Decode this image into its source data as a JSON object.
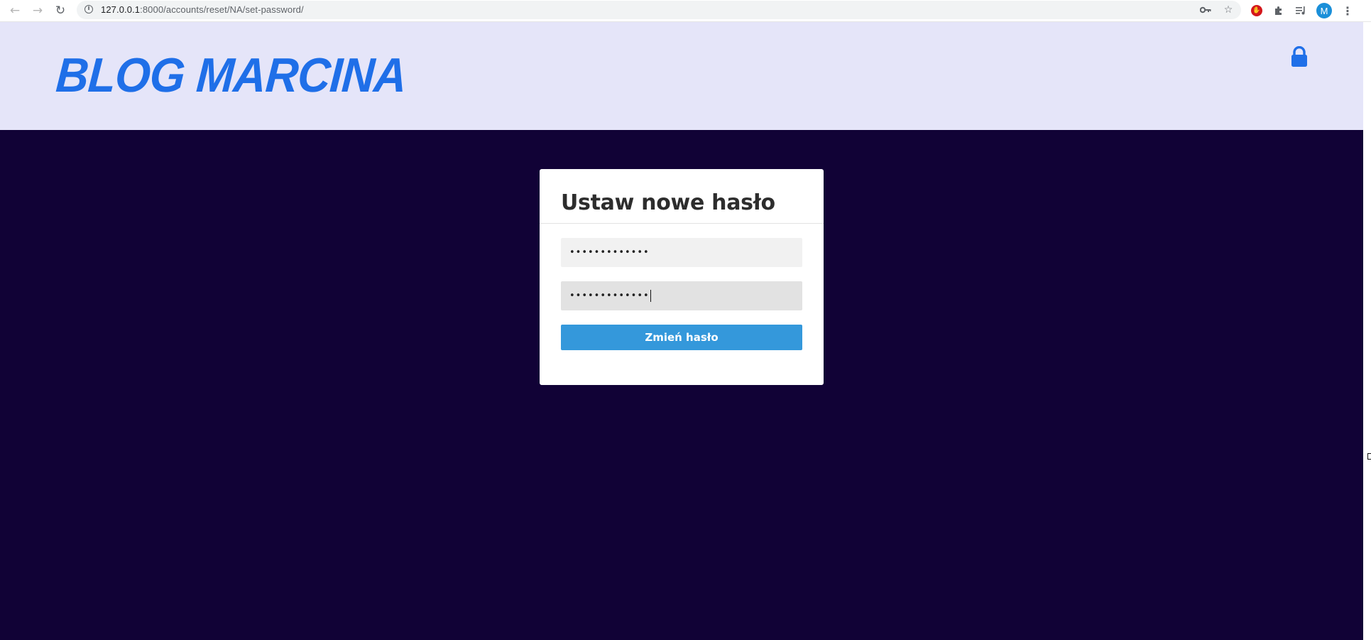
{
  "browser": {
    "back_icon": "arrow-left-icon",
    "forward_icon": "arrow-right-icon",
    "reload_icon": "reload-icon",
    "url_host": "127.0.0.1",
    "url_path": ":8000/accounts/reset/NA/set-password/",
    "avatar_letter": "M",
    "icons": [
      "info-icon",
      "key-icon",
      "star-icon",
      "stop-extension-icon",
      "puzzle-icon",
      "media-queue-icon",
      "kebab-menu-icon"
    ]
  },
  "header": {
    "logo": "Blog Marcina",
    "logo_color": "#1f6fe8",
    "background": "#e5e5f9",
    "lock_icon": "lock-icon"
  },
  "main": {
    "background": "#110236"
  },
  "form": {
    "title": "Ustaw nowe hasło",
    "new_password_value": "•••••••••••••",
    "confirm_password_value": "•••••••••••••",
    "submit_label": "Zmień hasło",
    "submit_color": "#3498db"
  }
}
